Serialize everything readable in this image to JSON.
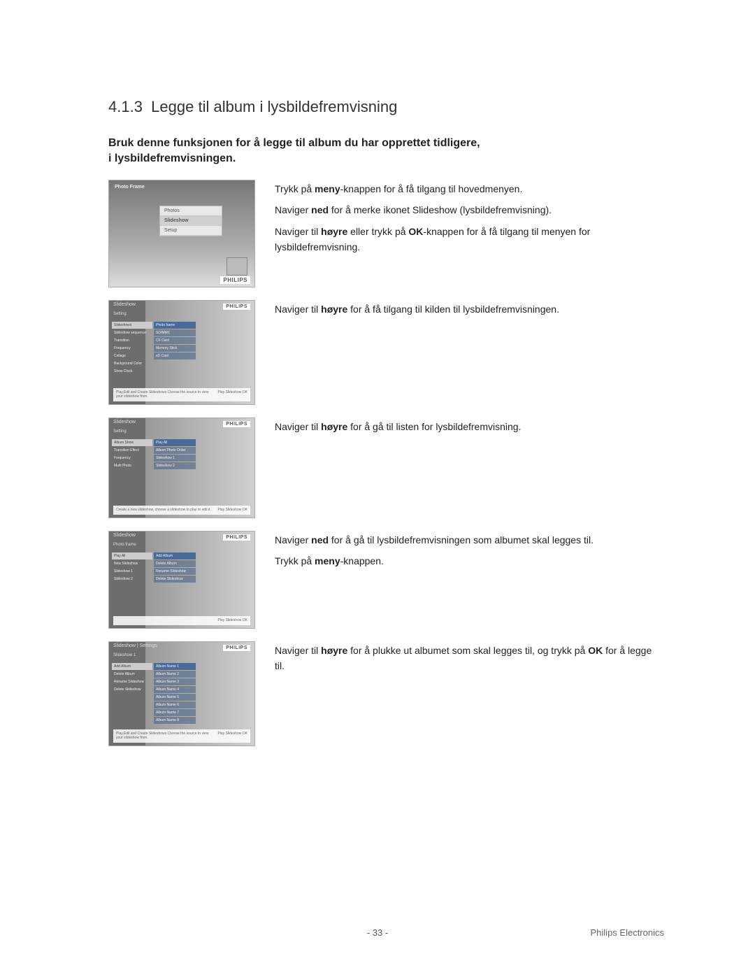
{
  "section_number": "4.1.3",
  "section_title": "Legge til album i lysbildefremvisning",
  "intro_line1": "Bruk denne funksjonen for å legge til album du har opprettet tidligere,",
  "intro_line2": "i lysbildefremvisningen.",
  "brand": "PHILIPS",
  "footer_brand": "Philips Electronics",
  "page_number": "- 33 -",
  "step1": {
    "p1_a": "Trykk på ",
    "p1_b": "meny",
    "p1_c": "-knappen for å få tilgang til hovedmenyen.",
    "p2_a": "Naviger ",
    "p2_b": "ned",
    "p2_c": " for å merke ikonet Slideshow (lysbildefremvisning).",
    "p3_a": "Naviger til ",
    "p3_b": "høyre",
    "p3_c": " eller trykk på ",
    "p3_d": "OK",
    "p3_e": "-knappen for å få tilgang til menyen for lysbildefremvisning.",
    "thumb": {
      "title": "Photo Frame",
      "menu": [
        "Photos",
        "Slideshow",
        "Setup"
      ]
    }
  },
  "step2": {
    "p1_a": "Naviger til ",
    "p1_b": "høyre",
    "p1_c": " for å få tilgang til kilden til lysbildefremvisningen.",
    "thumb": {
      "title": "Slideshow",
      "sub": "Setting",
      "col1": [
        "Slideshows",
        "Slideshow sequence",
        "Transition",
        "Frequency",
        "Collage",
        "Background Color",
        "Show Clock"
      ],
      "col2": [
        "Photo frame",
        "SD/MMC",
        "CF Card",
        "Memory Stick",
        "xD Card"
      ],
      "footer_left": "Play,Edit and Create Slideshows\nChoose the source to view your slideshow from.",
      "footer_right": "Play Slideshow\nOK"
    }
  },
  "step3": {
    "p1_a": "Naviger til ",
    "p1_b": "høyre",
    "p1_c": " for å gå til listen for lysbildefremvisning.",
    "thumb": {
      "title": "Slideshow",
      "sub": "Setting",
      "col1": [
        "Album Show",
        "Transition Effect",
        "Frequency",
        "Multi Photo"
      ],
      "col2": [
        "Play All",
        "Album Photo Order",
        "Slideshow 1",
        "Slideshow 2"
      ],
      "footer_left": "Create a new slideshow, choose a slideshow to play or edit it.",
      "footer_right": "Play Slideshow\nOK"
    }
  },
  "step4": {
    "p1_a": "Naviger ",
    "p1_b": "ned",
    "p1_c": " for å gå til lysbildefremvisningen som albumet skal legges til.",
    "p2_a": "Trykk på ",
    "p2_b": "meny",
    "p2_c": "-knappen.",
    "thumb": {
      "title": "Slideshow",
      "sub": "Photo frame",
      "col1": [
        "Play All",
        "New Slideshow",
        "Slideshow 1",
        "Slideshow 2"
      ],
      "col2": [
        "Add Album",
        "Delete Album",
        "Rename Slideshow",
        "Delete Slideshow"
      ],
      "footer_right": "Play Slideshow\nOK"
    }
  },
  "step5": {
    "p1_a": "Naviger til ",
    "p1_b": "høyre",
    "p1_c": " for å plukke ut albumet som skal legges til, og trykk på ",
    "p1_d": "OK",
    "p1_e": " for å legge til.",
    "thumb": {
      "title": "Slideshow | Settings",
      "sub": "Slideshow 1",
      "col1": [
        "Add Album",
        "Delete Album",
        "Rename Slideshow",
        "Delete Slideshow"
      ],
      "col2": [
        "Album Name 1",
        "Album Name 2",
        "Album Name 3",
        "Album Name 4",
        "Album Name 5",
        "Album Name 6",
        "Album Name 7",
        "Album Name 8"
      ],
      "footer_left": "Play,Edit and Create Slideshows\nChoose the source to view your slideshow from.",
      "footer_right": "Play Slideshow\nOK"
    }
  }
}
